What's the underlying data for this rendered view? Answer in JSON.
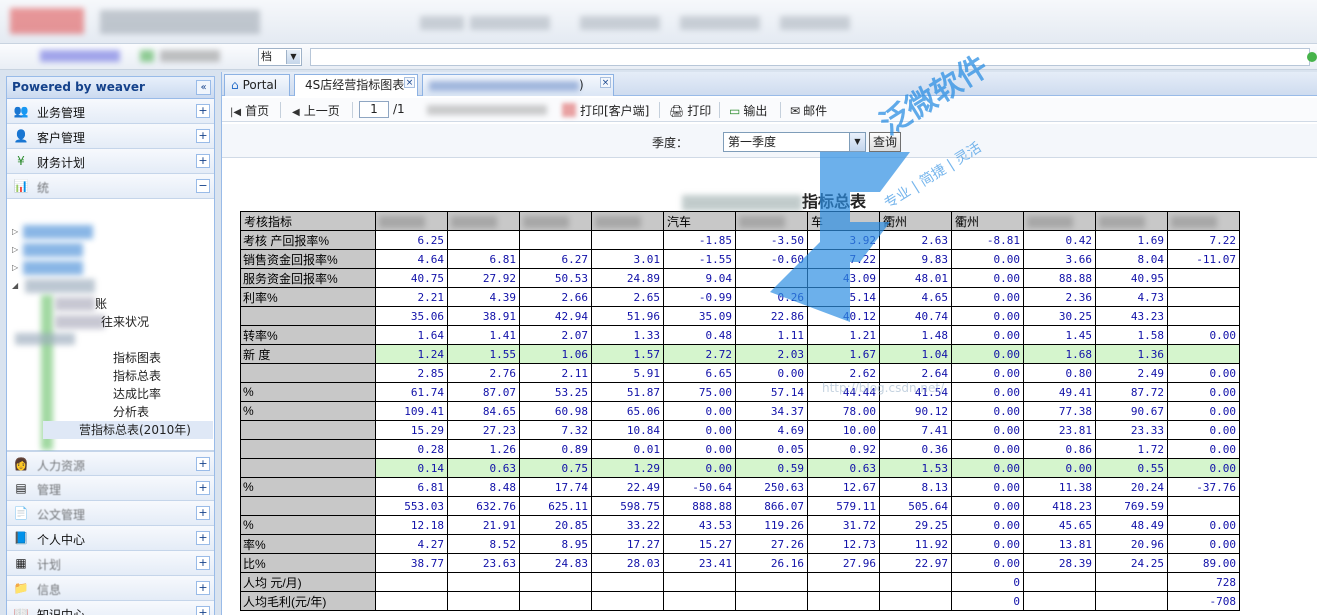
{
  "sidebar": {
    "header": "Powered by weaver",
    "collapse_glyph": "«",
    "items_top": [
      {
        "label": "业务管理",
        "icon": "users-icon",
        "glyph": "👥",
        "toggle": "+"
      },
      {
        "label": "客户管理",
        "icon": "customer-icon",
        "glyph": "👤",
        "toggle": "+"
      },
      {
        "label": "财务计划",
        "icon": "finance-icon",
        "glyph": "¥",
        "toggle": "+"
      }
    ],
    "expanded_item": {
      "label": "统",
      "icon": "stats-icon",
      "glyph": "📊",
      "toggle": "−"
    },
    "tree": [
      {
        "label": "账"
      },
      {
        "label": "往来状况"
      },
      {
        "label": "指标图表"
      },
      {
        "label": "指标总表"
      },
      {
        "label": "达成比率"
      },
      {
        "label": "分析表"
      },
      {
        "label": "营指标总表(2010年)"
      }
    ],
    "items_bottom": [
      {
        "label": "人力资源",
        "icon": "hr-icon",
        "glyph": "👩",
        "toggle": "+"
      },
      {
        "label": "管理",
        "icon": "admin-icon",
        "glyph": "▤",
        "toggle": "+"
      },
      {
        "label": "公文管理",
        "icon": "document-icon",
        "glyph": "📄",
        "toggle": "+"
      },
      {
        "label": "个人中心",
        "icon": "person-icon",
        "glyph": "📘",
        "toggle": "+"
      },
      {
        "label": "计划",
        "icon": "plan-icon",
        "glyph": "▦",
        "toggle": "+"
      },
      {
        "label": "信息",
        "icon": "info-icon",
        "glyph": "📁",
        "toggle": "+"
      },
      {
        "label": "知识中心",
        "icon": "book-icon",
        "glyph": "📖",
        "toggle": "+"
      }
    ]
  },
  "subbar": {
    "select_text": "档",
    "select_arrow": "▼"
  },
  "tabs": [
    {
      "label": "Portal",
      "icon": "portal-icon",
      "glyph": "⌂"
    },
    {
      "label": "4S店经营指标图表",
      "close": "×"
    },
    {
      "label": ")",
      "close": "×"
    }
  ],
  "toolbar": {
    "first": "首页",
    "first_glyph": "|◀",
    "prev": "上一页",
    "prev_glyph": "◀",
    "page": "1",
    "total": "/1",
    "print_client": "打印[客户端]",
    "print": "打印",
    "print_glyph": "🖨",
    "export": "输出",
    "export_glyph": "▭",
    "mail": "邮件",
    "mail_glyph": "✉"
  },
  "filter": {
    "label": "季度：",
    "value": "第一季度",
    "arrow": "▼",
    "button": "查询"
  },
  "report": {
    "title": "指标总表"
  },
  "watermark": {
    "brand": "泛微软件",
    "slogan": "专业 | 简捷 | 灵活",
    "url": "http://blog.csdn.net/"
  },
  "table": {
    "header": [
      "考核指标",
      "",
      "",
      "",
      "",
      "汽车",
      "",
      "车",
      "衢州",
      "衢州",
      "",
      "",
      ""
    ],
    "rows": [
      {
        "label": "考核 产回报率%",
        "green": false,
        "cells": [
          "6.25",
          "",
          "",
          "",
          "-1.85",
          "-3.50",
          "3.92",
          "2.63",
          "-8.81",
          "0.42",
          "1.69",
          "7.22"
        ]
      },
      {
        "label": "销售资金回报率%",
        "green": false,
        "cells": [
          "4.64",
          "6.81",
          "6.27",
          "3.01",
          "-1.55",
          "-0.60",
          "7.22",
          "9.83",
          "0.00",
          "3.66",
          "8.04",
          "-11.07"
        ]
      },
      {
        "label": "服务资金回报率%",
        "green": false,
        "cells": [
          "40.75",
          "27.92",
          "50.53",
          "24.89",
          "9.04",
          "",
          "43.09",
          "48.01",
          "0.00",
          "88.88",
          "40.95",
          ""
        ]
      },
      {
        "label": "利率%",
        "green": false,
        "cells": [
          "2.21",
          "4.39",
          "2.66",
          "2.65",
          "-0.99",
          "0.26",
          "5.14",
          "4.65",
          "0.00",
          "2.36",
          "4.73",
          ""
        ]
      },
      {
        "label": "",
        "green": false,
        "cells": [
          "35.06",
          "38.91",
          "42.94",
          "51.96",
          "35.09",
          "22.86",
          "40.12",
          "40.74",
          "0.00",
          "30.25",
          "43.23",
          ""
        ]
      },
      {
        "label": "转率%",
        "green": false,
        "cells": [
          "1.64",
          "1.41",
          "2.07",
          "1.33",
          "0.48",
          "1.11",
          "1.21",
          "1.48",
          "0.00",
          "1.45",
          "1.58",
          "0.00"
        ]
      },
      {
        "label": "新 度",
        "green": true,
        "cells": [
          "1.24",
          "1.55",
          "1.06",
          "1.57",
          "2.72",
          "2.03",
          "1.67",
          "1.04",
          "0.00",
          "1.68",
          "1.36",
          ""
        ]
      },
      {
        "label": "",
        "green": false,
        "cells": [
          "2.85",
          "2.76",
          "2.11",
          "5.91",
          "6.65",
          "0.00",
          "2.62",
          "2.64",
          "0.00",
          "0.80",
          "2.49",
          "0.00"
        ]
      },
      {
        "label": "%",
        "green": false,
        "cells": [
          "61.74",
          "87.07",
          "53.25",
          "51.87",
          "75.00",
          "57.14",
          "44.44",
          "41.54",
          "0.00",
          "49.41",
          "87.72",
          "0.00"
        ]
      },
      {
        "label": "%",
        "green": false,
        "cells": [
          "109.41",
          "84.65",
          "60.98",
          "65.06",
          "0.00",
          "34.37",
          "78.00",
          "90.12",
          "0.00",
          "77.38",
          "90.67",
          "0.00"
        ]
      },
      {
        "label": "",
        "green": false,
        "cells": [
          "15.29",
          "27.23",
          "7.32",
          "10.84",
          "0.00",
          "4.69",
          "10.00",
          "7.41",
          "0.00",
          "23.81",
          "23.33",
          "0.00"
        ]
      },
      {
        "label": "",
        "green": false,
        "cells": [
          "0.28",
          "1.26",
          "0.89",
          "0.01",
          "0.00",
          "0.05",
          "0.92",
          "0.36",
          "0.00",
          "0.86",
          "1.72",
          "0.00"
        ]
      },
      {
        "label": "",
        "green": true,
        "cells": [
          "0.14",
          "0.63",
          "0.75",
          "1.29",
          "0.00",
          "0.59",
          "0.63",
          "1.53",
          "0.00",
          "0.00",
          "0.55",
          "0.00"
        ]
      },
      {
        "label": "%",
        "green": false,
        "cells": [
          "6.81",
          "8.48",
          "17.74",
          "22.49",
          "-50.64",
          "250.63",
          "12.67",
          "8.13",
          "0.00",
          "11.38",
          "20.24",
          "-37.76"
        ]
      },
      {
        "label": "",
        "green": false,
        "cells": [
          "553.03",
          "632.76",
          "625.11",
          "598.75",
          "888.88",
          "866.07",
          "579.11",
          "505.64",
          "0.00",
          "418.23",
          "769.59",
          ""
        ]
      },
      {
        "label": "%",
        "green": false,
        "cells": [
          "12.18",
          "21.91",
          "20.85",
          "33.22",
          "43.53",
          "119.26",
          "31.72",
          "29.25",
          "0.00",
          "45.65",
          "48.49",
          "0.00"
        ]
      },
      {
        "label": "率%",
        "green": false,
        "cells": [
          "4.27",
          "8.52",
          "8.95",
          "17.27",
          "15.27",
          "27.26",
          "12.73",
          "11.92",
          "0.00",
          "13.81",
          "20.96",
          "0.00"
        ]
      },
      {
        "label": "比%",
        "green": false,
        "cells": [
          "38.77",
          "23.63",
          "24.83",
          "28.03",
          "23.41",
          "26.16",
          "27.96",
          "22.97",
          "0.00",
          "28.39",
          "24.25",
          "89.00"
        ]
      },
      {
        "label": "人均 元/月)",
        "green": false,
        "cells": [
          "",
          "",
          "",
          "",
          "",
          "",
          "",
          "",
          "0",
          "",
          "",
          "728"
        ]
      },
      {
        "label": "人均毛利(元/年)",
        "green": false,
        "cells": [
          "",
          "",
          "",
          "",
          "",
          "",
          "",
          "",
          "0",
          "",
          "",
          "-708"
        ]
      }
    ]
  }
}
